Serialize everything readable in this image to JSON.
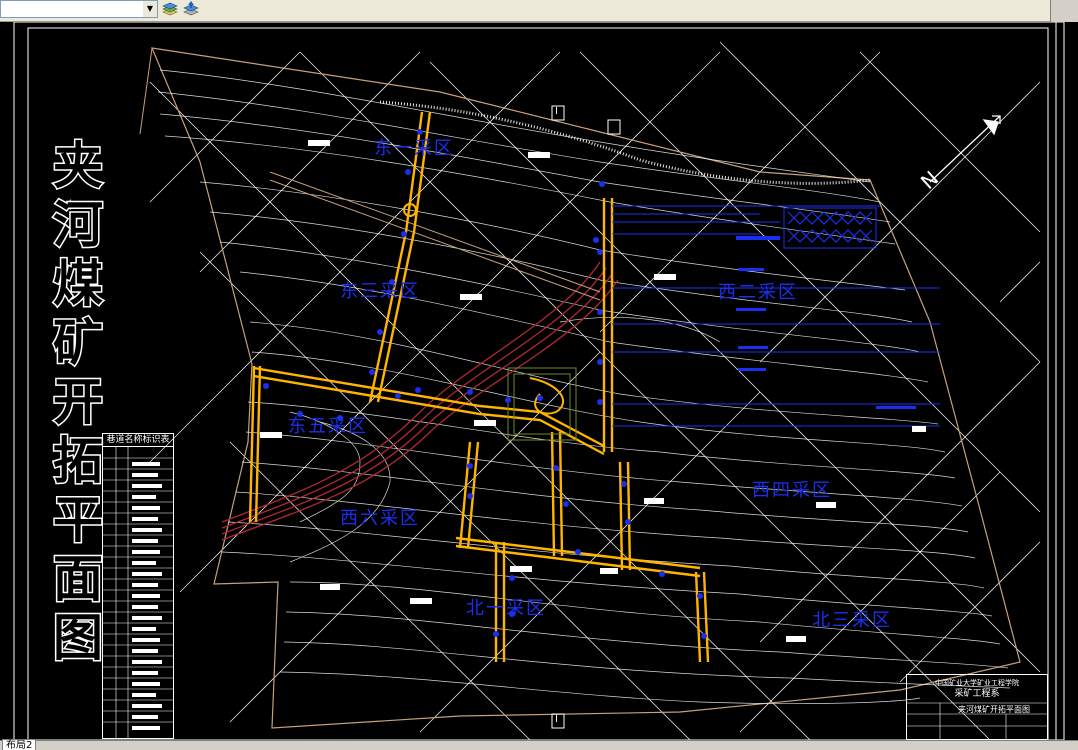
{
  "toolbar": {
    "layer_value": "",
    "icons": [
      "layer-states-icon",
      "layer-previous-icon"
    ]
  },
  "drawing": {
    "vertical_title_chars": [
      "夹",
      "河",
      "煤",
      "矿",
      "开",
      "拓",
      "平",
      "面",
      "图"
    ],
    "zones": {
      "east_1": "东一采区",
      "east_3": "东三采区",
      "west_2": "西二采区",
      "south_5": "东五采区",
      "west_4": "西四采区",
      "west_6": "西六采区",
      "north_1": "北一采区",
      "north_3": "北三采区"
    },
    "north_symbol": "N",
    "section_marks": [
      "I",
      "I"
    ],
    "legend_title": "巷道名称标识表",
    "title_block": {
      "organization": "中国矿业大学矿业工程学院",
      "department": "采矿工程系",
      "drawing_name": "夹河煤矿开拓平面图"
    }
  },
  "colors": {
    "background": "#000000",
    "contour": "#ffffff",
    "roadway": "#ffb400",
    "zone_label": "#1a2ff0",
    "boundary": "#c8a078",
    "shaft": "#b0282f"
  },
  "status": {
    "layout_tab": "布局2"
  }
}
